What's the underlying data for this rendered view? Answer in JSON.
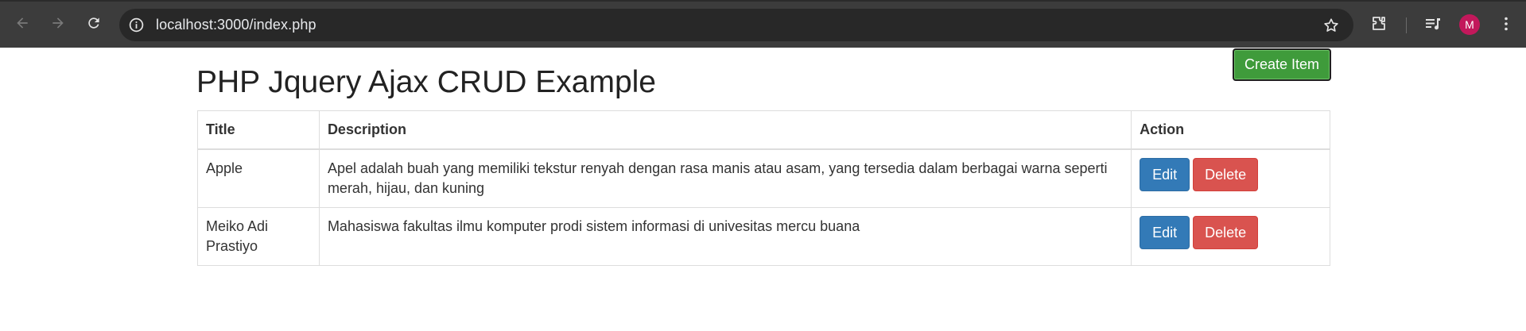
{
  "browser": {
    "url": "localhost:3000/index.php",
    "profile_initial": "M",
    "profile_color": "#c2185b"
  },
  "page": {
    "title": "PHP Jquery Ajax CRUD Example",
    "create_label": "Create Item"
  },
  "table": {
    "headers": {
      "title": "Title",
      "description": "Description",
      "action": "Action"
    },
    "rows": [
      {
        "title": "Apple",
        "description": "Apel adalah buah yang memiliki tekstur renyah dengan rasa manis atau asam, yang tersedia dalam berbagai warna seperti merah, hijau, dan kuning",
        "edit_label": "Edit",
        "delete_label": "Delete"
      },
      {
        "title": "Meiko Adi Prastiyo",
        "description": "Mahasiswa fakultas ilmu komputer prodi sistem informasi di univesitas mercu buana",
        "edit_label": "Edit",
        "delete_label": "Delete"
      }
    ]
  },
  "colors": {
    "create_button": "#3f9b3b",
    "edit_button": "#337ab7",
    "delete_button": "#d9534f"
  },
  "icons": [
    "back-arrow-icon",
    "forward-arrow-icon",
    "reload-icon",
    "site-info-icon",
    "bookmark-star-icon",
    "extensions-icon",
    "media-controls-icon",
    "kebab-menu-icon"
  ]
}
